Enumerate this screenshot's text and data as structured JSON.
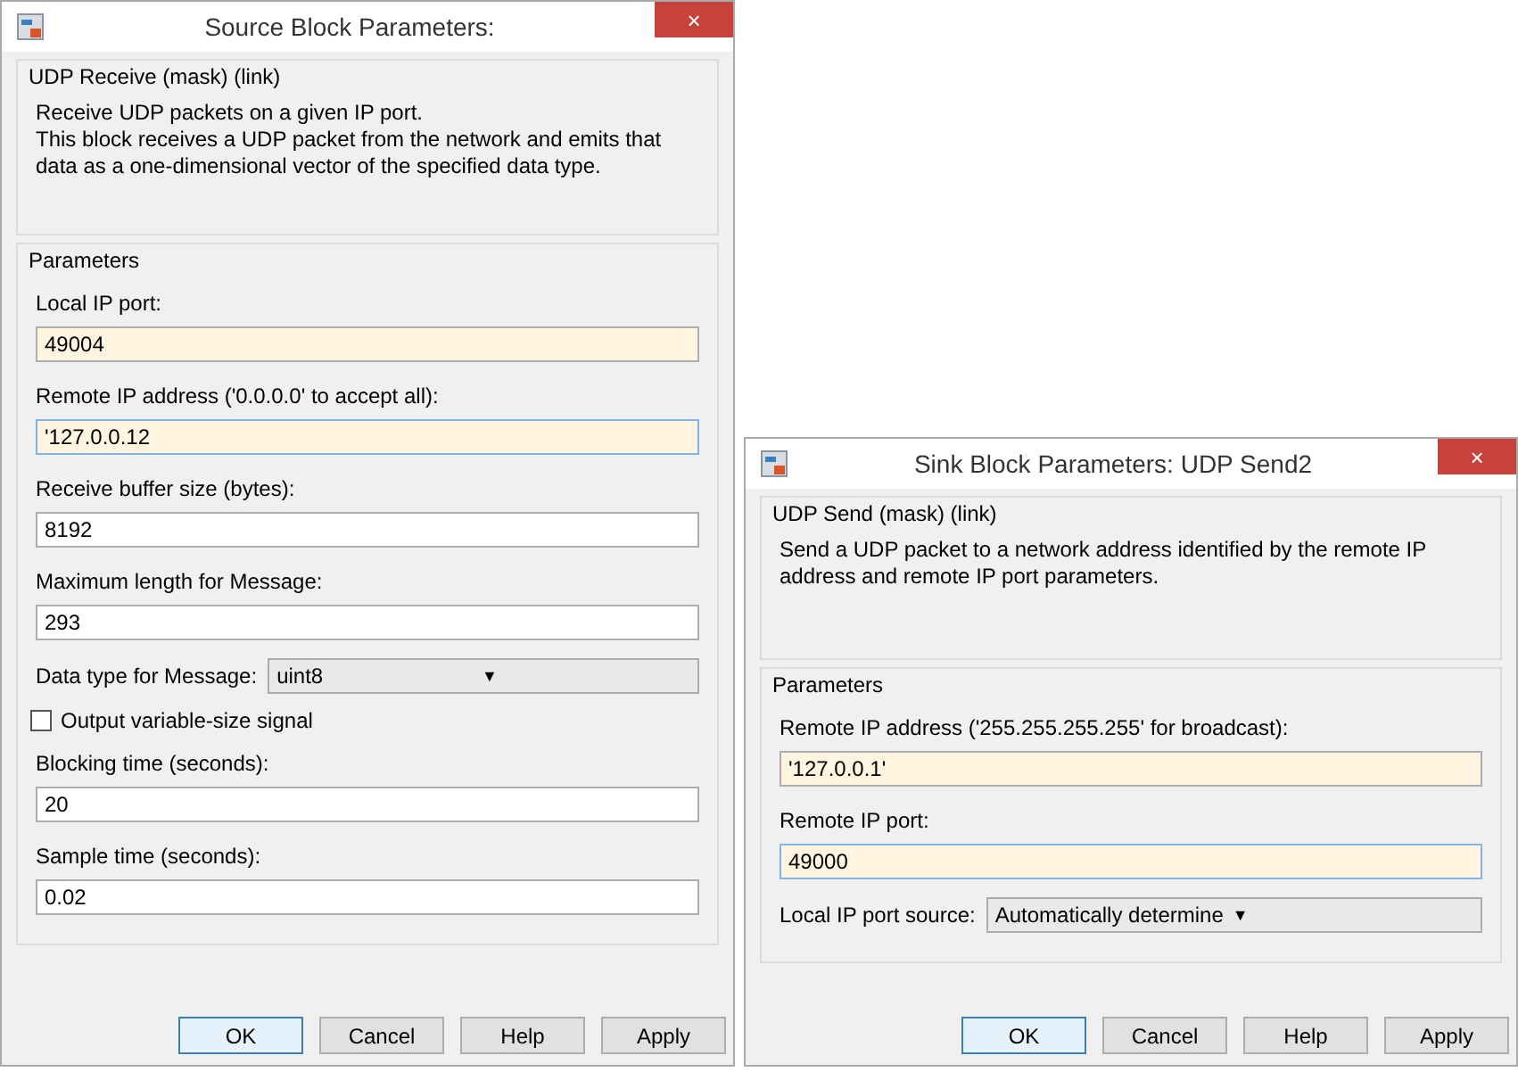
{
  "dialogs": [
    {
      "title": "Source Block Parameters:",
      "close": "×",
      "block": {
        "heading": "UDP Receive (mask) (link)",
        "description": "Receive UDP packets on a given IP port.\nThis block receives a UDP packet from the network and emits that data as a one-dimensional vector of the specified data type."
      },
      "parameters": {
        "heading": "Parameters",
        "fields": [
          {
            "kind": "text",
            "label": "Local IP port:",
            "value": "49004",
            "highlighted": true,
            "focused": false
          },
          {
            "kind": "text",
            "label": "Remote IP address ('0.0.0.0' to accept all):",
            "value": "'127.0.0.12",
            "highlighted": true,
            "focused": true
          },
          {
            "kind": "text",
            "label": "Receive buffer size (bytes):",
            "value": "8192",
            "highlighted": false,
            "focused": false
          },
          {
            "kind": "text",
            "label": "Maximum length for Message:",
            "value": "293",
            "highlighted": false,
            "focused": false
          },
          {
            "kind": "select",
            "label": "Data type for Message:",
            "value": "uint8",
            "arrow": "▼"
          },
          {
            "kind": "checkbox",
            "label": "Output variable-size signal",
            "checked": false
          },
          {
            "kind": "text",
            "label": "Blocking time (seconds):",
            "value": "20",
            "highlighted": false,
            "focused": false
          },
          {
            "kind": "text",
            "label": "Sample time (seconds):",
            "value": "0.02",
            "highlighted": false,
            "focused": false
          }
        ]
      },
      "buttons": [
        {
          "label": "OK",
          "default": true
        },
        {
          "label": "Cancel",
          "default": false
        },
        {
          "label": "Help",
          "default": false
        },
        {
          "label": "Apply",
          "default": false
        }
      ]
    },
    {
      "title": "Sink Block Parameters: UDP Send2",
      "close": "×",
      "block": {
        "heading": "UDP Send (mask) (link)",
        "description": "Send a UDP packet to a network address identified by the remote IP address and remote IP port parameters."
      },
      "parameters": {
        "heading": "Parameters",
        "fields": [
          {
            "kind": "text",
            "label": "Remote IP address ('255.255.255.255' for broadcast):",
            "value": "'127.0.0.1'",
            "highlighted": true,
            "focused": false
          },
          {
            "kind": "text",
            "label": "Remote IP port:",
            "value": "49000",
            "highlighted": true,
            "focused": true
          },
          {
            "kind": "select",
            "label": "Local IP port source:",
            "value": "Automatically determine",
            "arrow": "▼"
          }
        ]
      },
      "buttons": [
        {
          "label": "OK",
          "default": true
        },
        {
          "label": "Cancel",
          "default": false
        },
        {
          "label": "Help",
          "default": false
        },
        {
          "label": "Apply",
          "default": false
        }
      ]
    }
  ]
}
